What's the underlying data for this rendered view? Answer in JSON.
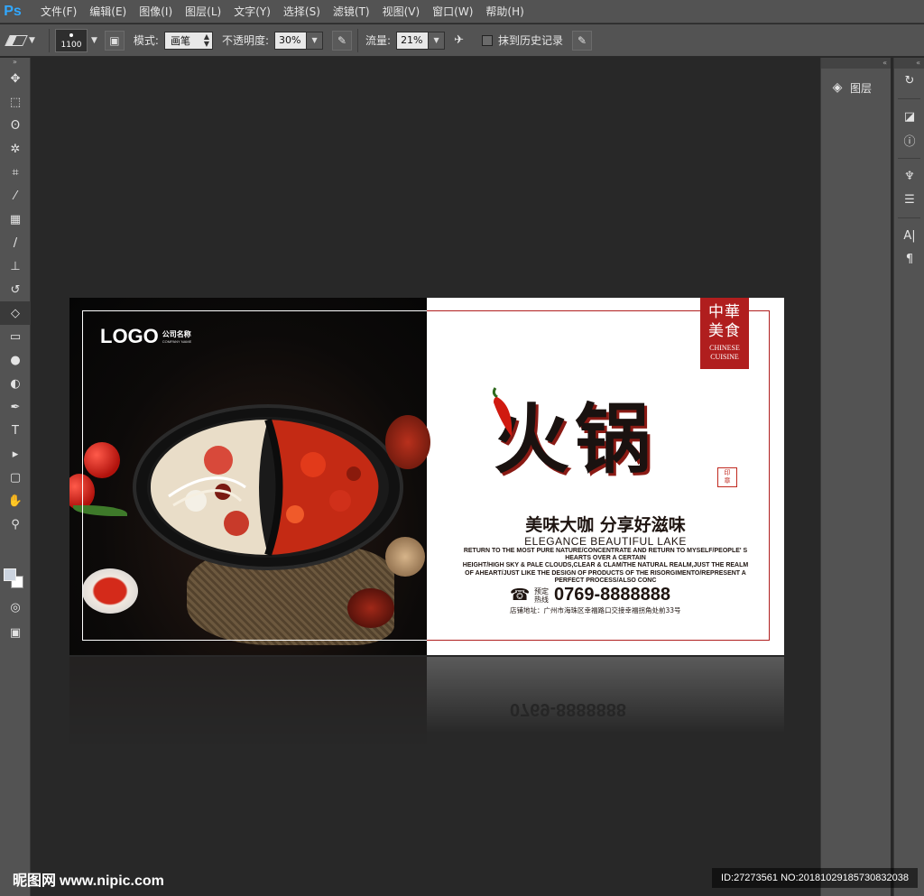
{
  "app": {
    "logo": "Ps"
  },
  "menu": [
    "文件(F)",
    "编辑(E)",
    "图像(I)",
    "图层(L)",
    "文字(Y)",
    "选择(S)",
    "滤镜(T)",
    "视图(V)",
    "窗口(W)",
    "帮助(H)"
  ],
  "options": {
    "brush_size": "1100",
    "mode_label": "模式:",
    "mode_value": "画笔",
    "opacity_label": "不透明度:",
    "opacity_value": "30%",
    "flow_label": "流量:",
    "flow_value": "21%",
    "history_label": "抹到历史记录"
  },
  "panels": {
    "layers_label": "图层"
  },
  "design": {
    "logo_text": "LOGO",
    "company_cn": "公司名称",
    "company_en": "COMPANY NAME",
    "badge_cn_1": "中華",
    "badge_cn_2": "美食",
    "badge_en_1": "CHINESE",
    "badge_en_2": "CUISINE",
    "title": "火锅",
    "slogan": "美味大咖 分享好滋味",
    "slogan_en": "ELEGANCE BEAUTIFUL LAKE",
    "desc_lines": [
      "RETURN TO THE MOST PURE NATURE/CONCENTRATE AND RETURN TO MYSELF/PEOPLE' S",
      "HEARTS OVER A CERTAIN",
      "HEIGHT/HIGH SKY & PALE CLOUDS,CLEAR & CLAM/THE NATURAL REALM,JUST THE REALM",
      "OF AHEART/JUST LIKE THE DESIGN OF PRODUCTS OF THE RISORGIMENTO/REPRESENT A",
      "PERFECT PROCESS/ALSO CONC"
    ],
    "phone_label_1": "预定",
    "phone_label_2": "热线",
    "phone": "0769-8888888",
    "address": "店铺地址：广州市海珠区幸福路口交接幸福拐角处前33号"
  },
  "watermark": {
    "site_cn": "昵图网",
    "site_url": "www.nipic.com",
    "id_text": "ID:27273561 NO:20181029185730832038"
  },
  "colors": {
    "accent": "#b01e1e",
    "chrome": "#535353",
    "canvas_bg": "#282828",
    "ps_blue": "#31a8ff"
  }
}
